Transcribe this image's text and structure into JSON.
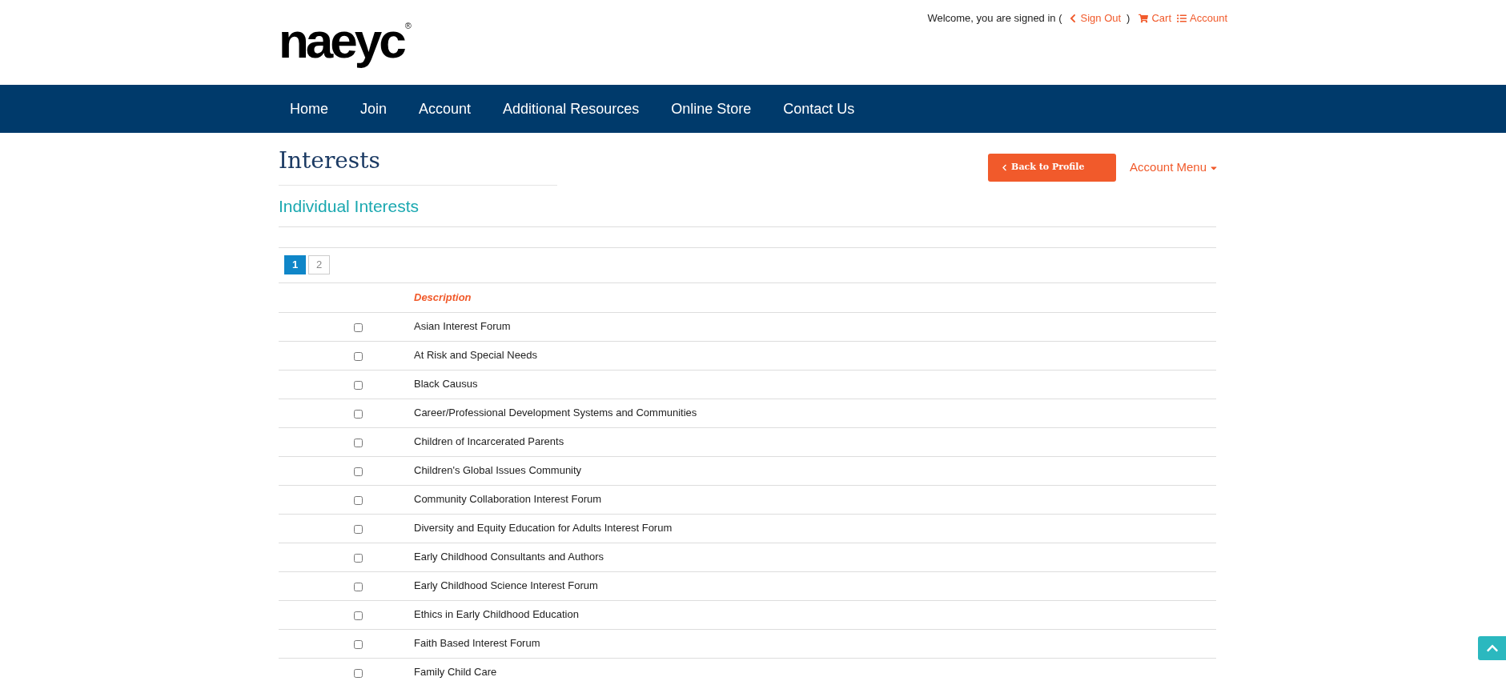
{
  "logo": {
    "text": "naeyc",
    "mark": "®"
  },
  "user_bar": {
    "welcome": "Welcome, you are signed in (",
    "close": ")",
    "links": [
      {
        "kind": "signout",
        "label": "Sign Out"
      },
      {
        "kind": "cart",
        "label": "Cart"
      },
      {
        "kind": "account",
        "label": "Account"
      }
    ]
  },
  "nav": [
    "Home",
    "Join",
    "Account",
    "Additional Resources",
    "Online Store",
    "Contact Us"
  ],
  "page_title": "Interests",
  "back_button": "Back to Profile",
  "account_menu": "Account Menu",
  "section_title": "Individual Interests",
  "pages": [
    {
      "label": "1",
      "selected": true
    },
    {
      "label": "2",
      "selected": false
    }
  ],
  "table": {
    "columns": [
      "Description"
    ],
    "rows": [
      {
        "label": "Asian Interest Forum",
        "checked": false
      },
      {
        "label": "At Risk and Special Needs",
        "checked": false
      },
      {
        "label": "Black Causus",
        "checked": false
      },
      {
        "label": "Career/Professional Development Systems and Communities",
        "checked": false
      },
      {
        "label": "Children of Incarcerated Parents",
        "checked": false
      },
      {
        "label": "Children's Global Issues Community",
        "checked": false
      },
      {
        "label": "Community Collaboration Interest Forum",
        "checked": false
      },
      {
        "label": "Diversity and Equity Education for Adults Interest Forum",
        "checked": false
      },
      {
        "label": "Early Childhood Consultants and Authors",
        "checked": false
      },
      {
        "label": "Early Childhood Science Interest Forum",
        "checked": false
      },
      {
        "label": "Ethics in Early Childhood Education",
        "checked": false
      },
      {
        "label": "Faith Based Interest Forum",
        "checked": false
      },
      {
        "label": "Family Child Care",
        "checked": false
      }
    ]
  }
}
